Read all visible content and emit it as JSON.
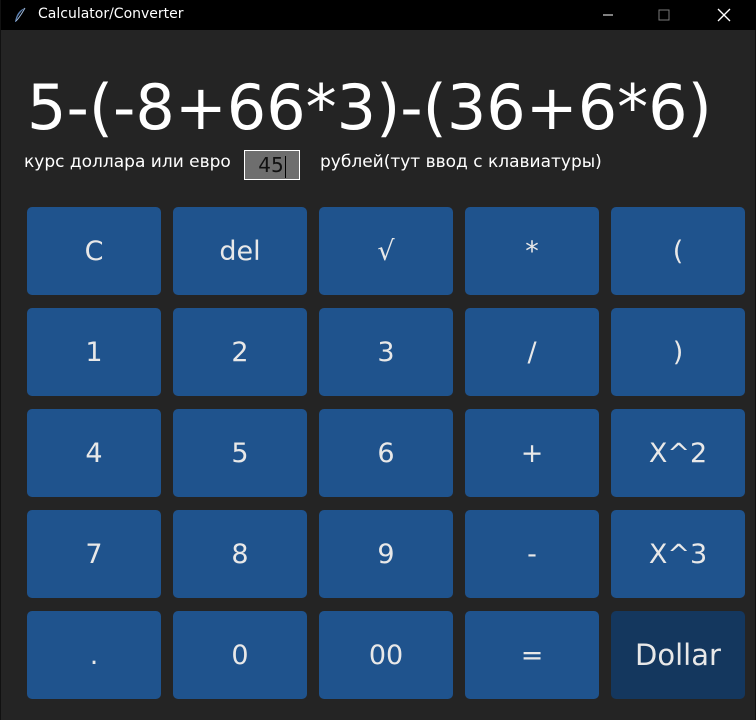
{
  "window": {
    "title": "Calculator/Converter"
  },
  "display": {
    "expression": "5-(-8+66*3)-(36+6*6)"
  },
  "rate": {
    "label": "курс доллара или евро",
    "value": "45",
    "unit": "рублей(тут ввод с клавиатуры)"
  },
  "keypad": {
    "keys": [
      "C",
      "del",
      "√",
      "*",
      "(",
      "1",
      "2",
      "3",
      "/",
      ")",
      "4",
      "5",
      "6",
      "+",
      "X^2",
      "7",
      "8",
      "9",
      "-",
      "X^3",
      ".",
      "0",
      "00",
      "=",
      "Dollar"
    ]
  },
  "colors": {
    "window_bg": "#242424",
    "titlebar_bg": "#000000",
    "key_bg": "#1f538d",
    "key_active_bg": "#14375e",
    "input_bg": "#6e6e6e"
  },
  "icons": {
    "app": "feather-icon",
    "minimize": "minimize-icon",
    "maximize": "maximize-icon",
    "close": "close-icon"
  }
}
